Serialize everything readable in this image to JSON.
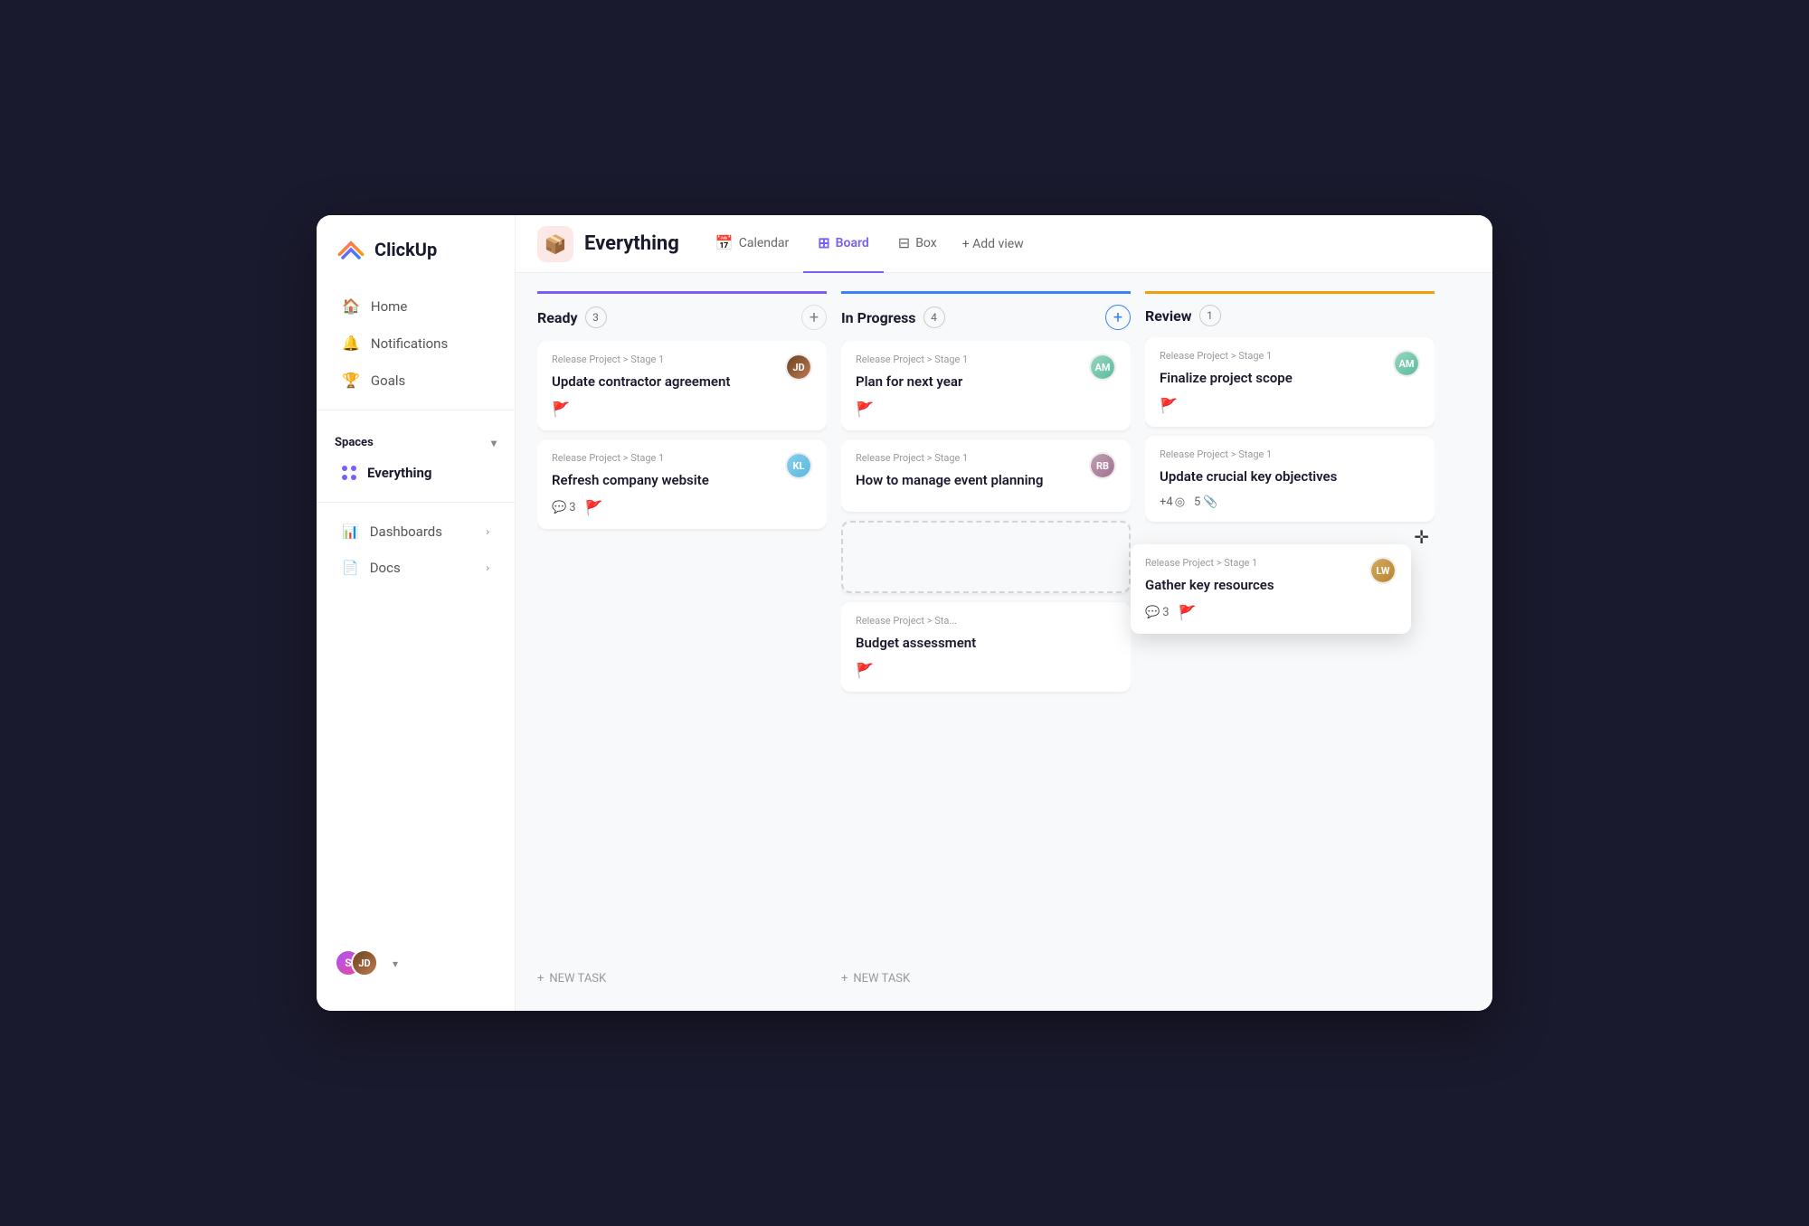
{
  "app": {
    "name": "ClickUp"
  },
  "sidebar": {
    "nav_items": [
      {
        "id": "home",
        "label": "Home",
        "icon": "🏠"
      },
      {
        "id": "notifications",
        "label": "Notifications",
        "icon": "🔔"
      },
      {
        "id": "goals",
        "label": "Goals",
        "icon": "🏆"
      }
    ],
    "spaces_label": "Spaces",
    "everything_label": "Everything",
    "bottom_nav": [
      {
        "id": "dashboards",
        "label": "Dashboards",
        "has_expand": true
      },
      {
        "id": "docs",
        "label": "Docs",
        "has_expand": true
      }
    ],
    "user_chevron": "▾"
  },
  "topbar": {
    "page_title": "Everything",
    "tabs": [
      {
        "id": "calendar",
        "label": "Calendar",
        "icon": "📅",
        "active": false
      },
      {
        "id": "board",
        "label": "Board",
        "icon": "⊞",
        "active": true
      },
      {
        "id": "box",
        "label": "Box",
        "icon": "⊟",
        "active": false
      }
    ],
    "add_view_label": "+ Add view"
  },
  "board": {
    "columns": [
      {
        "id": "ready",
        "title": "Ready",
        "count": 3,
        "color": "#7b5ff5",
        "cards": [
          {
            "id": "card-1",
            "meta": "Release Project > Stage 1",
            "title": "Update contractor agreement",
            "flag": "orange",
            "avatar_color": "#8B4513",
            "avatar_initials": "JD"
          },
          {
            "id": "card-2",
            "meta": "Release Project > Stage 1",
            "title": "Refresh company website",
            "flag": "green",
            "comments": 3,
            "avatar_color": "#87CEEB",
            "avatar_initials": "KL"
          }
        ],
        "new_task_label": "+ NEW TASK"
      },
      {
        "id": "inprogress",
        "title": "In Progress",
        "count": 4,
        "color": "#3b82f6",
        "cards": [
          {
            "id": "card-3",
            "meta": "Release Project > Stage 1",
            "title": "Plan for next year",
            "flag": "red",
            "avatar_color": "#98d5c0",
            "avatar_initials": "AM"
          },
          {
            "id": "card-4",
            "meta": "Release Project > Stage 1",
            "title": "How to manage event planning",
            "flag": null,
            "avatar_color": "#c0a0b0",
            "avatar_initials": "RB"
          },
          {
            "id": "card-dashed",
            "dashed": true
          },
          {
            "id": "card-5",
            "meta": "Release Project > Sta...",
            "title": "Budget assessment",
            "flag": "orange",
            "avatar_color": null,
            "avatar_initials": null
          }
        ],
        "new_task_label": "+ NEW TASK"
      },
      {
        "id": "review",
        "title": "Review",
        "count": 1,
        "color": "#f59e0b",
        "cards": [
          {
            "id": "card-6",
            "meta": "Release Project > Stage 1",
            "title": "Finalize project scope",
            "flag": "red",
            "avatar_color": "#98d5c0",
            "avatar_initials": "AM"
          },
          {
            "id": "card-7",
            "meta": "Release Project > Stage 1",
            "title": "Update crucial key objectives",
            "flag": null,
            "extra": "+4",
            "comments": 5,
            "has_attachment": true
          }
        ]
      }
    ],
    "floating_card": {
      "meta": "Release Project > Stage 1",
      "title": "Gather key resources",
      "comments": 3,
      "flag": "green",
      "avatar_color": "#d4a862",
      "avatar_initials": "LW"
    }
  }
}
